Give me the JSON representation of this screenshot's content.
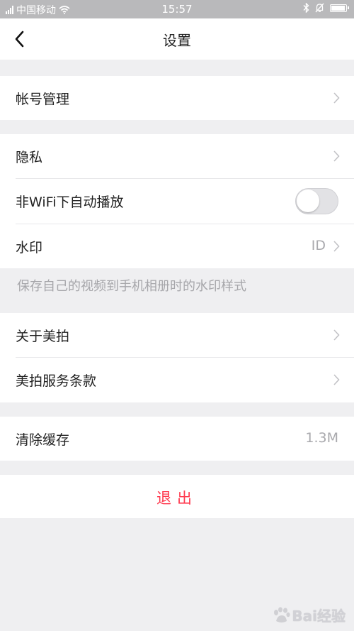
{
  "status_bar": {
    "carrier": "中国移动",
    "time": "15:57",
    "battery_level": 0.85,
    "icons": [
      "signal-icon",
      "wifi-icon",
      "bluetooth-icon",
      "mute-bell-icon",
      "battery-icon"
    ]
  },
  "header": {
    "title": "设置",
    "back_icon": "chevron-left-icon"
  },
  "settings": {
    "account": {
      "label": "帐号管理"
    },
    "privacy": {
      "label": "隐私"
    },
    "autoplay": {
      "label": "非WiFi下自动播放",
      "enabled": false
    },
    "watermark": {
      "label": "水印",
      "value": "ID"
    },
    "watermark_hint": "保存自己的视频到手机相册时的水印样式",
    "about": {
      "label": "关于美拍"
    },
    "terms": {
      "label": "美拍服务条款"
    },
    "cache": {
      "label": "清除缓存",
      "value": "1.3M"
    }
  },
  "logout": {
    "label": "退出"
  },
  "watermark_overlay": {
    "text": "Bai经验"
  },
  "colors": {
    "background": "#efeff1",
    "accent_red": "#ff3a4f",
    "status_bar": "#b9b9bb",
    "secondary_text": "#a9a9ad"
  }
}
